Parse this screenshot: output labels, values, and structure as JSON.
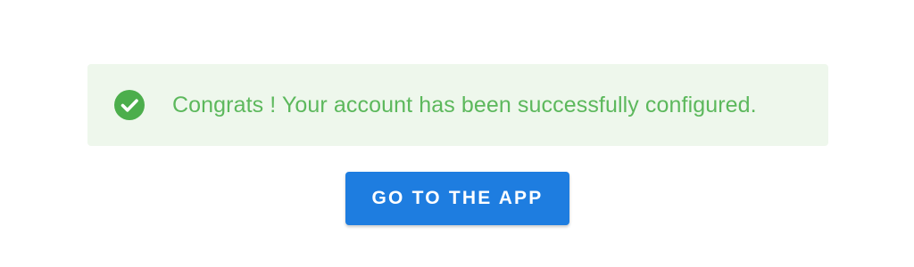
{
  "alert": {
    "icon": "check-circle-icon",
    "message": "Congrats ! Your account has been successfully configured.",
    "text_color": "#5cb85c",
    "background_color": "#eef7ec"
  },
  "cta": {
    "label": "GO TO THE APP",
    "background_color": "#1e7de0"
  }
}
